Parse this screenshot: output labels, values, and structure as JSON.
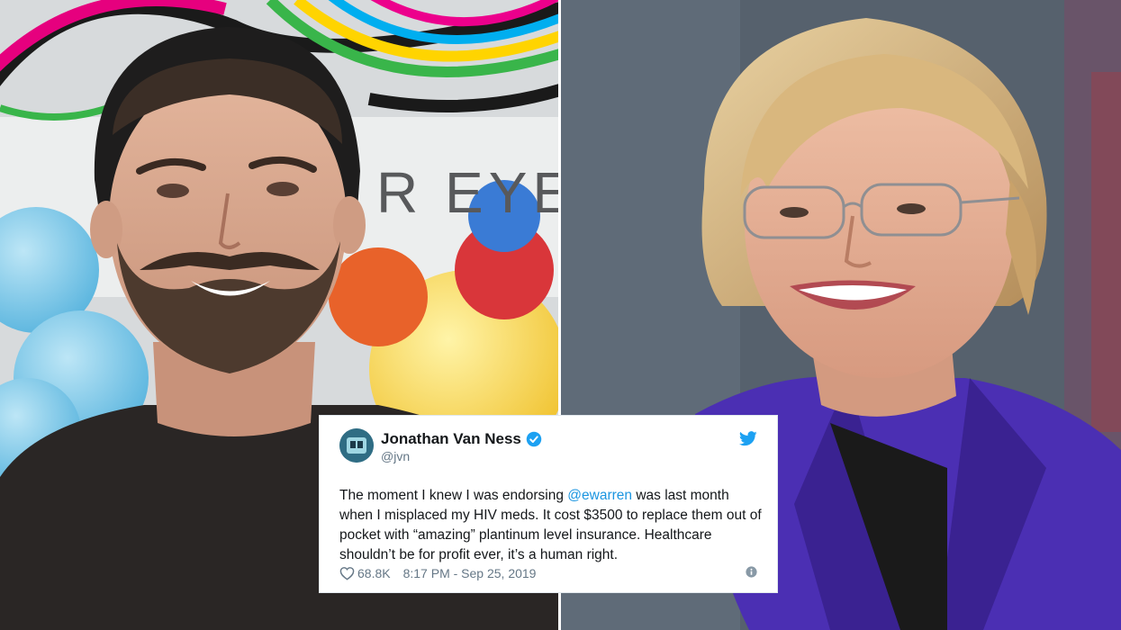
{
  "tweet": {
    "display_name": "Jonathan Van Ness",
    "handle": "@jvn",
    "text_before": "The moment I knew I was endorsing ",
    "mention": "@ewarren",
    "text_after": " was last month when I misplaced my HIV meds. It cost $3500 to replace them out of pocket with “amazing” plantinum level insurance. Healthcare shouldn’t be for profit ever, it’s a human right.",
    "likes": "68.8K",
    "timestamp": "8:17 PM - Sep 25, 2019",
    "icons": {
      "verified": "verified-badge-icon",
      "brand": "twitter-bird-icon",
      "like": "heart-icon",
      "info": "info-icon"
    }
  },
  "backdrop_text": "R EYE",
  "colors": {
    "mention": "#1b95e0",
    "verified": "#1da1f2",
    "suit": "#4b2fb3"
  }
}
